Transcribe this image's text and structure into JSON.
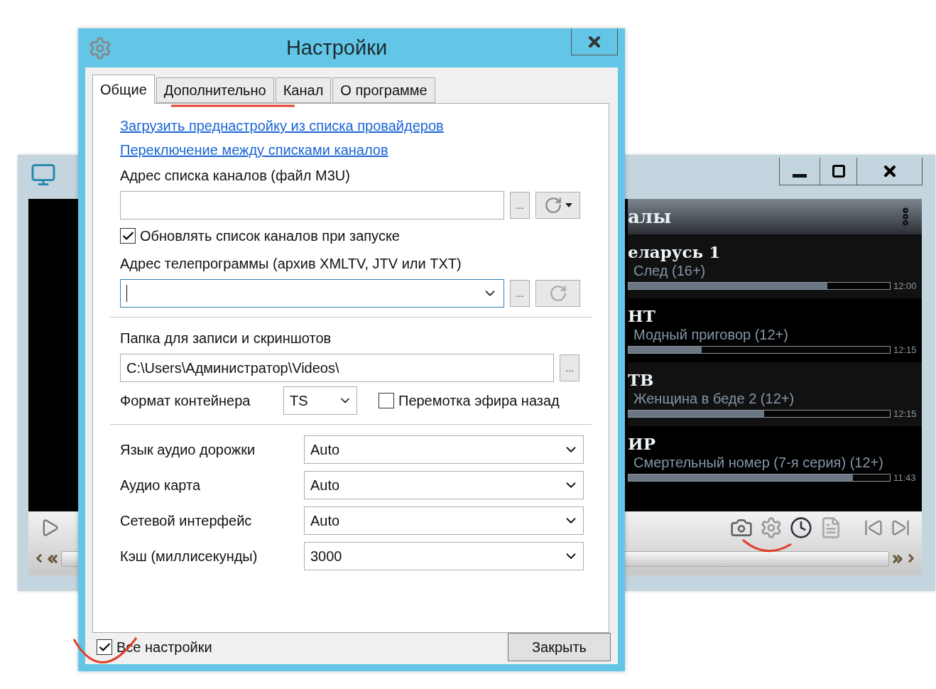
{
  "player": {
    "panel_title": "алы",
    "channels": [
      {
        "name": "еларусь 1",
        "program": "След (16+)",
        "level": 0.76,
        "time": "12:00"
      },
      {
        "name": "НТ",
        "program": "Модный приговор (12+)",
        "level": 0.28,
        "time": "12:15"
      },
      {
        "name": "ТВ",
        "program": "Женщина в беде 2 (12+)",
        "level": 0.52,
        "time": "12:15"
      },
      {
        "name": "ИР",
        "program": "Смертельный номер (7-я серия) (12+)",
        "level": 0.86,
        "time": "11:43"
      }
    ]
  },
  "dialog": {
    "title": "Настройки",
    "tabs": [
      {
        "label": "Общие",
        "selected": true
      },
      {
        "label": "Дополнительно",
        "selected": false
      },
      {
        "label": "Канал",
        "selected": false
      },
      {
        "label": "О программе",
        "selected": false
      }
    ],
    "links": [
      "Загрузить преднастройку из списка провайдеров",
      "Переключение между списками каналов"
    ],
    "playlist": {
      "label": "Адрес списка каналов (файл M3U)",
      "browse": "..."
    },
    "update_on_start": {
      "label": "Обновлять список каналов при запуске",
      "checked": true
    },
    "epg": {
      "label": "Адрес телепрограммы (архив XMLTV, JTV или TXT)",
      "browse": "..."
    },
    "record_folder": {
      "label": "Папка для записи и скриншотов",
      "value": "C:\\Users\\Администратор\\Videos\\",
      "browse": "..."
    },
    "container": {
      "label": "Формат контейнера",
      "value": "TS"
    },
    "rewind": {
      "label": "Перемотка эфира назад",
      "checked": false
    },
    "selects": [
      {
        "label": "Язык аудио дорожки",
        "value": "Auto"
      },
      {
        "label": "Аудио карта",
        "value": "Auto"
      },
      {
        "label": "Сетевой интерфейс",
        "value": "Auto"
      },
      {
        "label": "Кэш (миллисекунды)",
        "value": "3000"
      }
    ],
    "all_settings": {
      "label": "Все настройки",
      "checked": true
    },
    "close_button": "Закрыть"
  }
}
